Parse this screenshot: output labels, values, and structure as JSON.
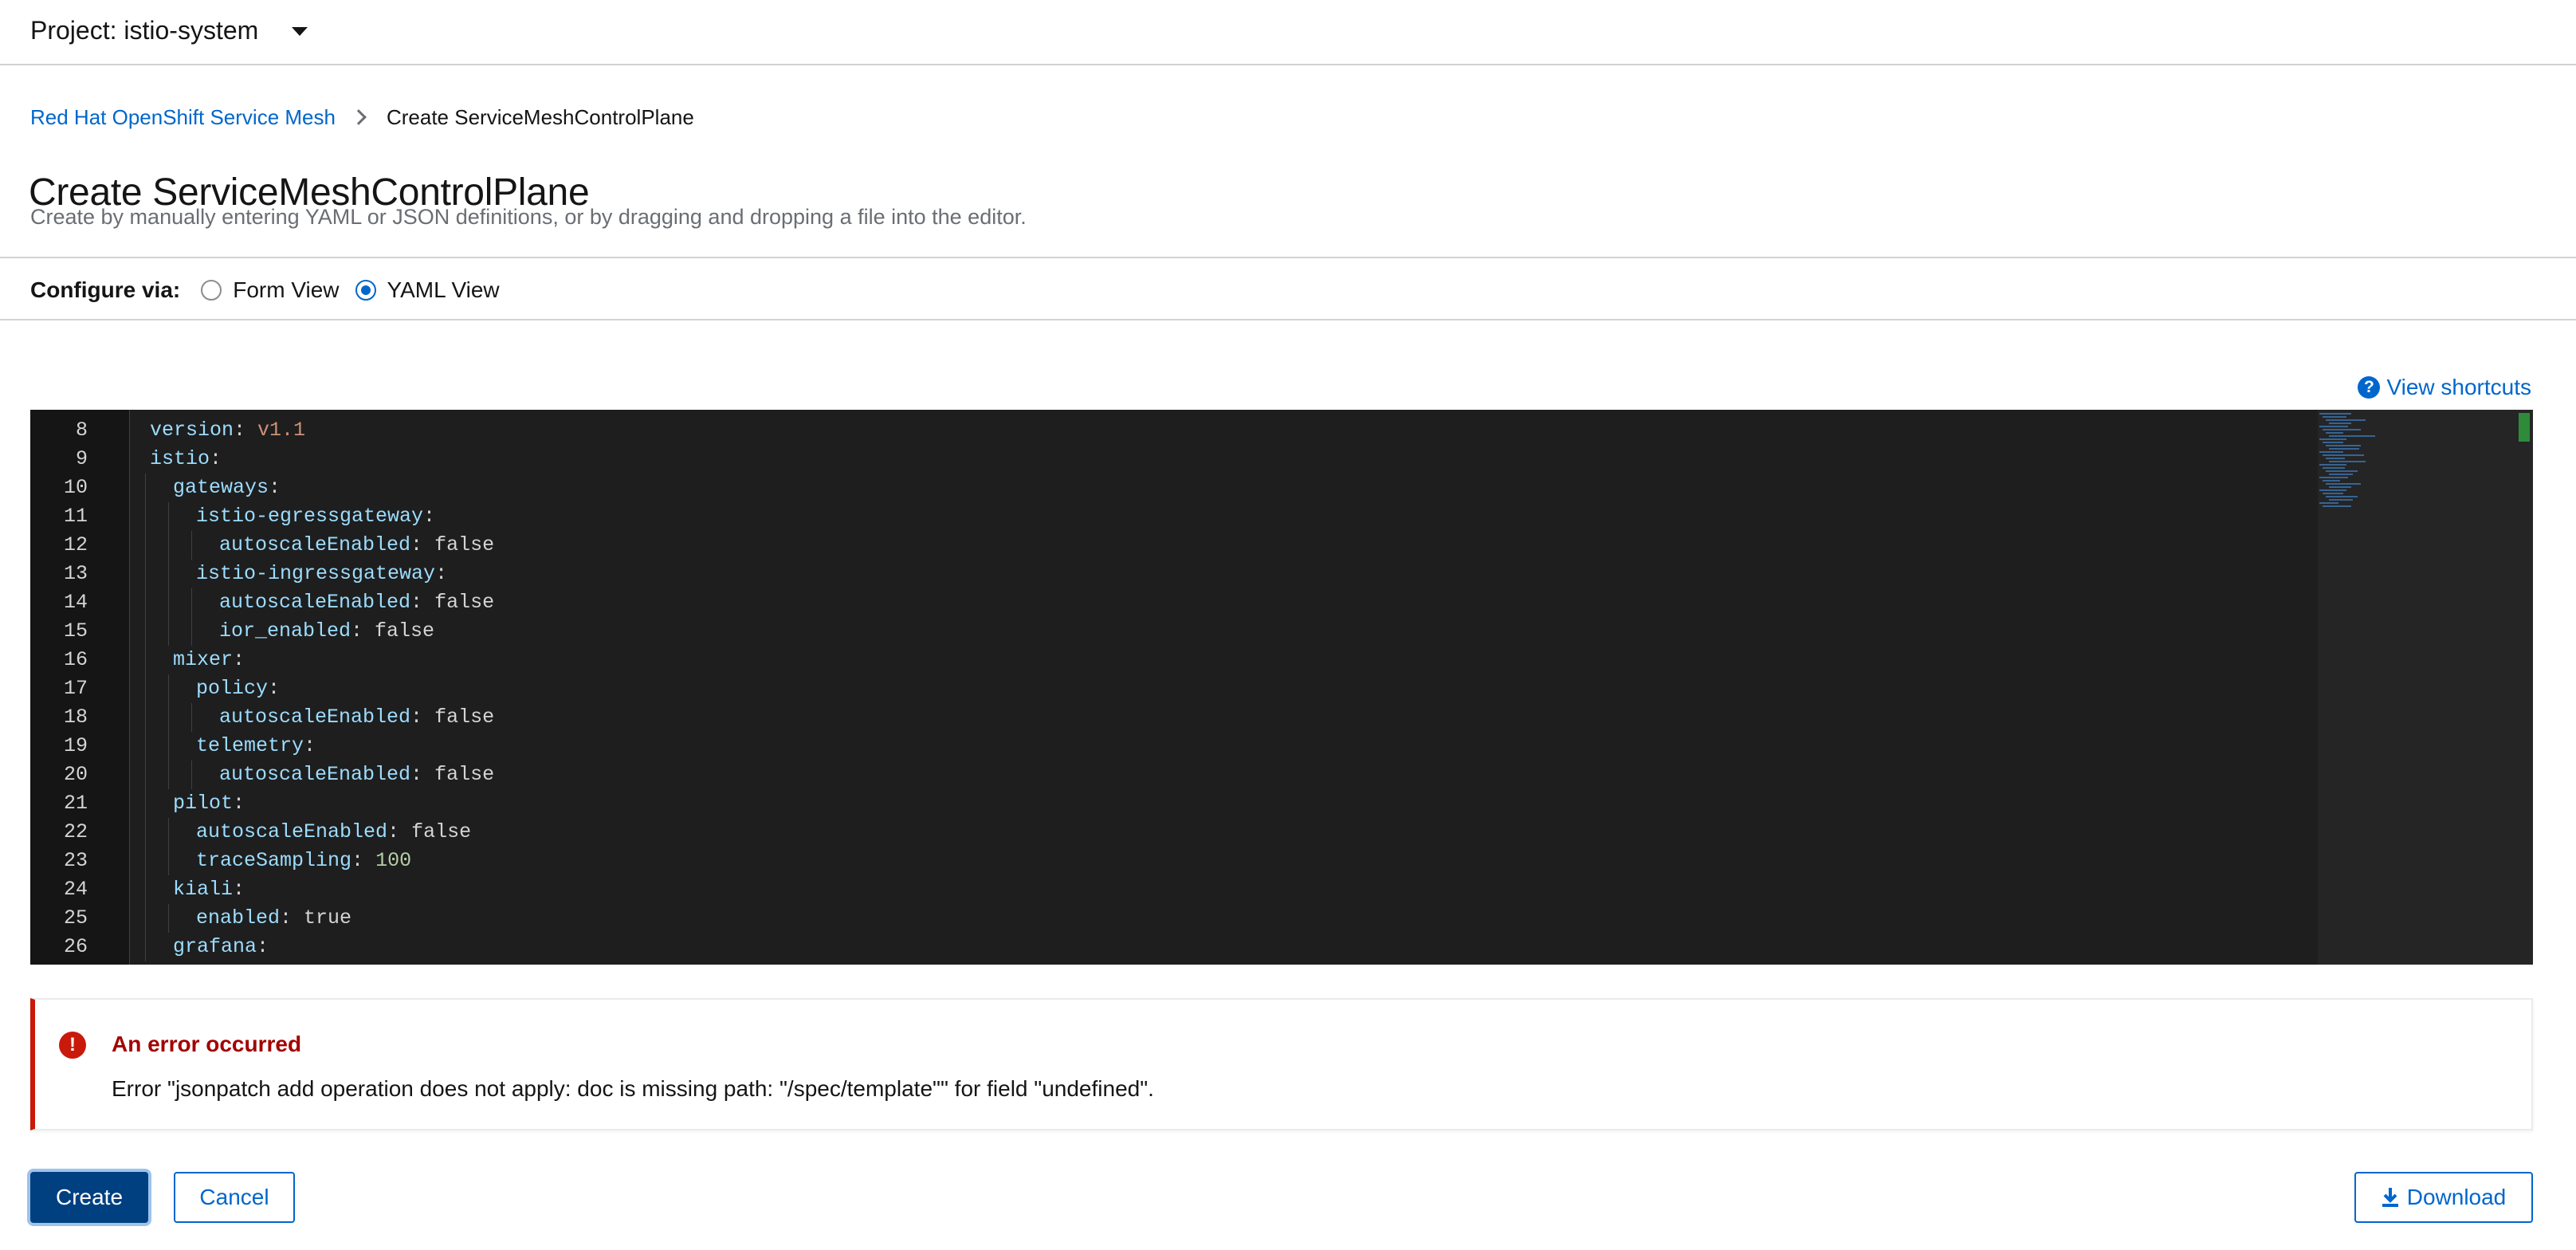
{
  "project": {
    "label": "Project: istio-system"
  },
  "breadcrumb": {
    "parent": "Red Hat OpenShift Service Mesh",
    "current": "Create ServiceMeshControlPlane"
  },
  "page": {
    "title": "Create ServiceMeshControlPlane",
    "description": "Create by manually entering YAML or JSON definitions, or by dragging and dropping a file into the editor."
  },
  "configure": {
    "label": "Configure via:",
    "options": [
      {
        "label": "Form View",
        "selected": false
      },
      {
        "label": "YAML View",
        "selected": true
      }
    ]
  },
  "shortcuts": {
    "label": "View shortcuts"
  },
  "editor": {
    "lines": [
      {
        "n": "8",
        "key": "version",
        "sep": ": ",
        "val": "v1.1",
        "vt": "vs"
      },
      {
        "n": "9",
        "key": "istio",
        "sep": ":",
        "val": "",
        "vt": "vb"
      },
      {
        "n": "10",
        "key": "gateways",
        "sep": ":",
        "val": "",
        "vt": "vb"
      },
      {
        "n": "11",
        "key": "istio-egressgateway",
        "sep": ":",
        "val": "",
        "vt": "vb"
      },
      {
        "n": "12",
        "key": "autoscaleEnabled",
        "sep": ": ",
        "val": "false",
        "vt": "vb"
      },
      {
        "n": "13",
        "key": "istio-ingressgateway",
        "sep": ":",
        "val": "",
        "vt": "vb"
      },
      {
        "n": "14",
        "key": "autoscaleEnabled",
        "sep": ": ",
        "val": "false",
        "vt": "vb"
      },
      {
        "n": "15",
        "key": "ior_enabled",
        "sep": ": ",
        "val": "false",
        "vt": "vb"
      },
      {
        "n": "16",
        "key": "mixer",
        "sep": ":",
        "val": "",
        "vt": "vb"
      },
      {
        "n": "17",
        "key": "policy",
        "sep": ":",
        "val": "",
        "vt": "vb"
      },
      {
        "n": "18",
        "key": "autoscaleEnabled",
        "sep": ": ",
        "val": "false",
        "vt": "vb"
      },
      {
        "n": "19",
        "key": "telemetry",
        "sep": ":",
        "val": "",
        "vt": "vb"
      },
      {
        "n": "20",
        "key": "autoscaleEnabled",
        "sep": ": ",
        "val": "false",
        "vt": "vb"
      },
      {
        "n": "21",
        "key": "pilot",
        "sep": ":",
        "val": "",
        "vt": "vb"
      },
      {
        "n": "22",
        "key": "autoscaleEnabled",
        "sep": ": ",
        "val": "false",
        "vt": "vb"
      },
      {
        "n": "23",
        "key": "traceSampling",
        "sep": ": ",
        "val": "100",
        "vt": "vn"
      },
      {
        "n": "24",
        "key": "kiali",
        "sep": ":",
        "val": "",
        "vt": "vb"
      },
      {
        "n": "25",
        "key": "enabled",
        "sep": ": ",
        "val": "true",
        "vt": "vb"
      },
      {
        "n": "26",
        "key": "grafana",
        "sep": ":",
        "val": "",
        "vt": "vb"
      }
    ]
  },
  "alert": {
    "title": "An error occurred",
    "message": "Error \"jsonpatch add operation does not apply: doc is missing path: \"/spec/template\"\" for field \"undefined\"."
  },
  "buttons": {
    "create": "Create",
    "cancel": "Cancel",
    "download": "Download"
  },
  "colors": {
    "accent": "#0066cc",
    "danger": "#c9190b",
    "primary_button": "#004080"
  }
}
